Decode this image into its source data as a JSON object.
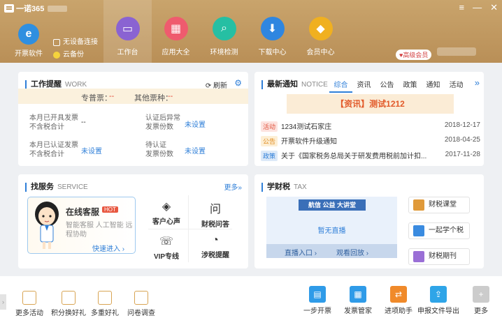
{
  "app": {
    "title": "一诺365",
    "win_menu": "≡",
    "win_min": "—",
    "win_close": "✕"
  },
  "top": {
    "invoice_software": "开票软件",
    "no_device": "无设备连接",
    "cloud_backup": "云备份",
    "vip_badge": "♥高级会员",
    "nav": [
      {
        "label": "工作台",
        "color": "#8a63d2",
        "icon": "monitor-icon"
      },
      {
        "label": "应用大全",
        "color": "#ef5b6e",
        "icon": "apps-grid-icon"
      },
      {
        "label": "环境检测",
        "color": "#26bfa3",
        "icon": "magnifier-icon"
      },
      {
        "label": "下载中心",
        "color": "#2f86e0",
        "icon": "download-icon"
      },
      {
        "label": "会员中心",
        "color": "#f0b020",
        "icon": "diamond-icon"
      }
    ]
  },
  "work": {
    "title": "工作提醒",
    "en": "WORK",
    "refresh": "刷新",
    "special_label": "专普票：",
    "special_val": "--",
    "other_label": "其他票种：",
    "other_val": "--",
    "rows": [
      {
        "label1": "本月已开具发票",
        "label2": "不含税合计",
        "value": "--"
      },
      {
        "label1": "认证后异常",
        "label2": "发票份数",
        "value": "未设置"
      },
      {
        "label1": "本月已认证发票",
        "label2": "不含税合计",
        "value": "未设置"
      },
      {
        "label1": "待认证",
        "label2": "发票份数",
        "value": "未设置"
      }
    ]
  },
  "notice": {
    "title": "最新通知",
    "en": "NOTICE",
    "tabs": [
      "综合",
      "资讯",
      "公告",
      "政策",
      "通知",
      "活动"
    ],
    "more": "»",
    "banner": "【资讯】测试1212",
    "items": [
      {
        "tag": "活动",
        "tag_bg": "#fde3df",
        "tag_color": "#e0533d",
        "text": "1234测试石家庄",
        "date": "2018-12-17"
      },
      {
        "tag": "公告",
        "tag_bg": "#fdefd5",
        "tag_color": "#e08a1d",
        "text": "开票软件升级通知",
        "date": "2018-04-25"
      },
      {
        "tag": "政策",
        "tag_bg": "#dce9f8",
        "tag_color": "#2f7fd8",
        "text": "关于《国家税务总局关于研发费用税前加计扣...",
        "date": "2017-11-28"
      }
    ]
  },
  "service": {
    "title": "找服务",
    "en": "SERVICE",
    "more": "更多»",
    "online": "在线客服",
    "hot": "HOT",
    "desc1": "智能客服 人工智能 远",
    "desc2": "程协助",
    "enter": "快速进入 ›",
    "items": [
      {
        "label": "客户心声",
        "icon": "◈"
      },
      {
        "label": "财税问答",
        "icon": "问"
      },
      {
        "label": "VIP专线",
        "icon": "☏"
      },
      {
        "label": "涉税提醒",
        "icon": "◔"
      }
    ]
  },
  "tax": {
    "title": "学财税",
    "en": "TAX",
    "banner": "航信 公益 大讲堂",
    "live": "暂无直播",
    "entry": "直播入口 ›",
    "replay": "观看回放 ›",
    "buttons": [
      {
        "label": "财税课堂",
        "color": "#e09a3a"
      },
      {
        "label": "一起学个税",
        "color": "#3a8be0"
      },
      {
        "label": "财税期刊",
        "color": "#9a6fd6"
      }
    ]
  },
  "bottom": {
    "left": [
      {
        "label": "更多活动"
      },
      {
        "label": "积分换好礼"
      },
      {
        "label": "多重好礼"
      },
      {
        "label": "问卷调查"
      }
    ],
    "right": [
      {
        "label": "一步开票",
        "color": "#2f9be8",
        "icon": "▤"
      },
      {
        "label": "发票管家",
        "color": "#2f9be8",
        "icon": "▦"
      },
      {
        "label": "进项助手",
        "color": "#f08a2a",
        "icon": "⇄"
      },
      {
        "label": "申报文件导出",
        "color": "#2fa5e8",
        "icon": "⇪"
      },
      {
        "label": "更多",
        "color": "#cccccc",
        "icon": "+"
      }
    ]
  }
}
